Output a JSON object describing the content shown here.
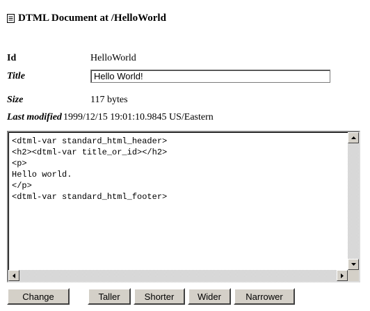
{
  "header": {
    "title": "DTML Document at /HelloWorld",
    "icon": "document-icon"
  },
  "fields": {
    "id_label": "Id",
    "id_value": "HelloWorld",
    "title_label": "Title",
    "title_value": "Hello World!",
    "size_label": "Size",
    "size_value": "117 bytes",
    "modified_label": "Last modified",
    "modified_value": "1999/12/15 19:01:10.9845 US/Eastern"
  },
  "editor": {
    "content": "<dtml-var standard_html_header>\n<h2><dtml-var title_or_id></h2>\n<p>\nHello world.\n</p>\n<dtml-var standard_html_footer>"
  },
  "buttons": {
    "change": "Change",
    "taller": "Taller",
    "shorter": "Shorter",
    "wider": "Wider",
    "narrower": "Narrower"
  }
}
